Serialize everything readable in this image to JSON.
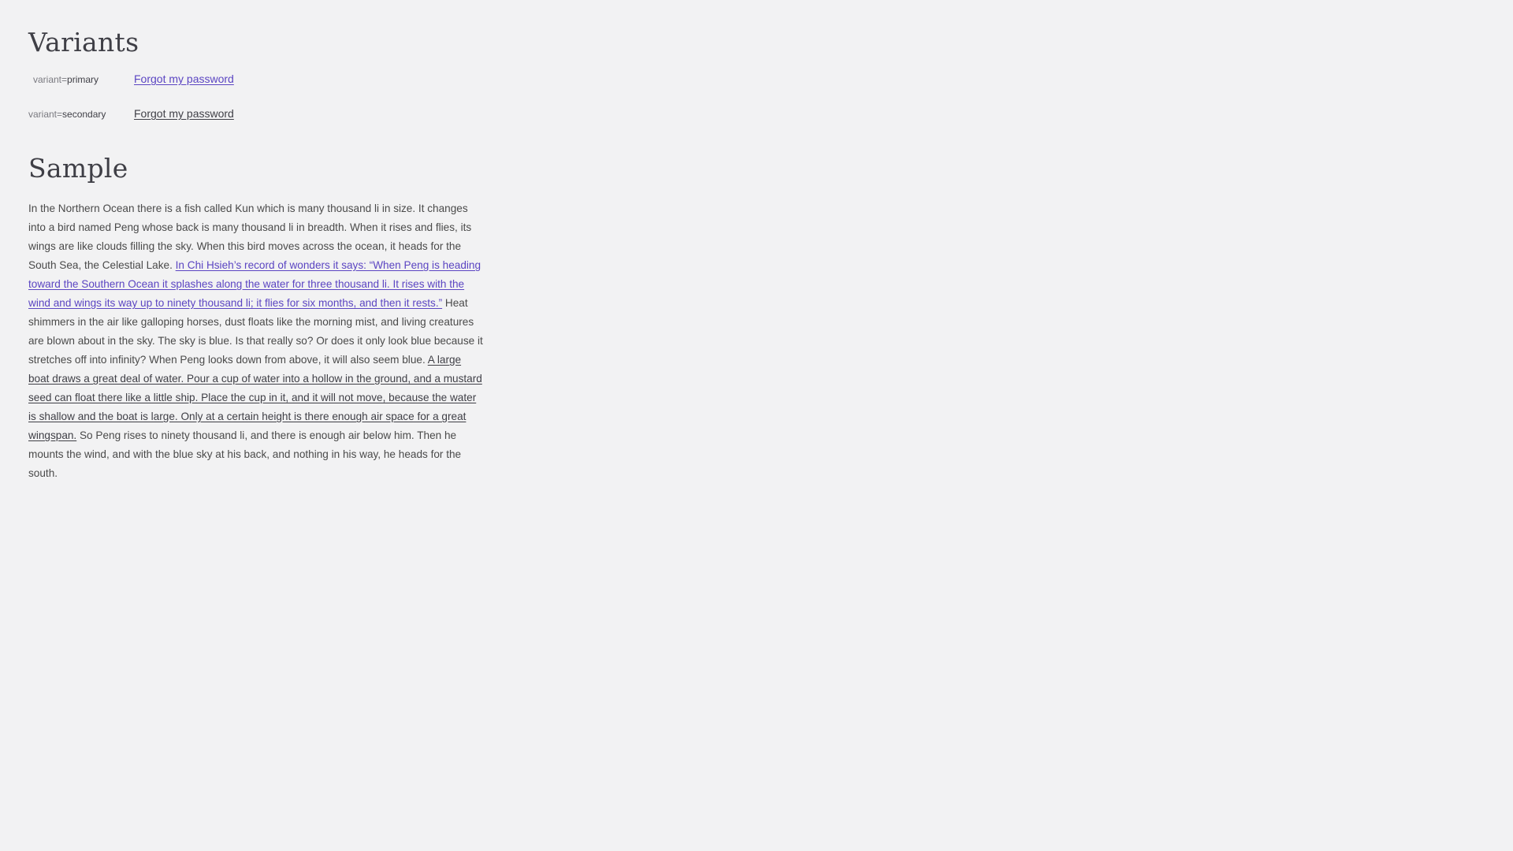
{
  "variants": {
    "title": "Variants",
    "rows": [
      {
        "key": "variant=",
        "value": "primary",
        "link_text": "Forgot my password"
      },
      {
        "key": "variant=",
        "value": "secondary",
        "link_text": "Forgot my password"
      }
    ]
  },
  "sample": {
    "title": "Sample",
    "text_1": "In the Northern Ocean there is a fish called Kun which is many thousand li in size. It changes into a bird named Peng whose back is many thousand li in breadth. When it rises and flies, its wings are like clouds filling the sky. When this bird moves across the ocean, it heads for the South Sea, the Celestial Lake. ",
    "link_1": "In Chi Hsieh’s record of wonders it says: “When Peng is heading toward the Southern Ocean it splashes along the water for three thousand li. It rises with the wind and wings its way up to ninety thousand li; it flies for six months, and then it rests.”",
    "text_2": " Heat shimmers in the air like galloping horses, dust floats like the morning mist, and living creatures are blown about in the sky. The sky is blue. Is that really so? Or does it only look blue because it stretches off into infinity? When Peng looks down from above, it will also seem blue. ",
    "link_2": "A large boat draws a great deal of water. Pour a cup of water into a hollow in the ground, and a mustard seed can float there like a little ship. Place the cup in it, and it will not move, because the water is shallow and the boat is large. Only at a certain height is there enough air space for a great wingspan.",
    "text_3": " So Peng rises to ninety thousand li, and there is enough air below him. Then he mounts the wind, and with the blue sky at his back, and nothing in his way, he heads for the south."
  },
  "colors": {
    "background": "#f2f2f3",
    "primary_link": "#5b45c2",
    "secondary_link": "#3f3f46",
    "body_text": "#4a4a4a"
  }
}
